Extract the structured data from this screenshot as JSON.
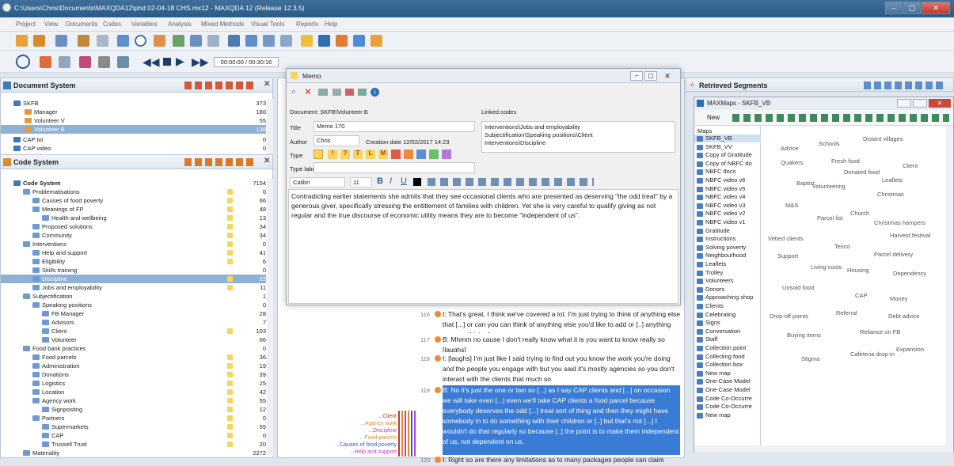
{
  "app": {
    "title": "C:\\Users\\Chris\\Documents\\MAXQDA12\\phd 02-04-18 CHS.mx12 - MAXQDA 12 (Release 12.3.5)"
  },
  "menu": [
    "Project",
    "View",
    "Documents",
    "Codes",
    "Variables",
    "Analysis",
    "Mixed Methods",
    "Visual Tools",
    "Reports",
    "Help"
  ],
  "media": {
    "time": "00:00:00 / 00:30:16"
  },
  "doc_system": {
    "title": "Document System",
    "items": [
      {
        "label": "SKFB",
        "count": "373",
        "indent": 0,
        "sel": false
      },
      {
        "label": "Manager",
        "count": "180",
        "indent": 1,
        "sel": false
      },
      {
        "label": "Volunteer V",
        "count": "55",
        "indent": 1,
        "sel": false
      },
      {
        "label": "Volunteer B",
        "count": "138",
        "indent": 1,
        "sel": true
      },
      {
        "label": "CAP txt",
        "count": "0",
        "indent": 0,
        "sel": false
      },
      {
        "label": "CAP video",
        "count": "0",
        "indent": 0,
        "sel": false
      }
    ]
  },
  "code_system": {
    "title": "Code System",
    "items": [
      {
        "label": "Code System",
        "count": "7154",
        "indent": 0,
        "bold": true,
        "sel": false,
        "y": false
      },
      {
        "label": "Problematisations",
        "count": "0",
        "indent": 1,
        "sel": false,
        "y": true
      },
      {
        "label": "Causes of food poverty",
        "count": "66",
        "indent": 2,
        "sel": false,
        "y": true
      },
      {
        "label": "Meanings of FP",
        "count": "48",
        "indent": 2,
        "sel": false,
        "y": true
      },
      {
        "label": "Health and wellbeing",
        "count": "13",
        "indent": 3,
        "sel": false,
        "y": true
      },
      {
        "label": "Proposed solutions",
        "count": "34",
        "indent": 2,
        "sel": false,
        "y": true
      },
      {
        "label": "Community",
        "count": "34",
        "indent": 2,
        "sel": false,
        "y": true
      },
      {
        "label": "Interventions",
        "count": "0",
        "indent": 1,
        "sel": false,
        "y": true
      },
      {
        "label": "Help and support",
        "count": "41",
        "indent": 2,
        "sel": false,
        "y": true
      },
      {
        "label": "Eligibility",
        "count": "6",
        "indent": 2,
        "sel": false,
        "y": true
      },
      {
        "label": "Skills training",
        "count": "0",
        "indent": 2,
        "sel": false,
        "y": false
      },
      {
        "label": "Discipline",
        "count": "22",
        "indent": 2,
        "sel": true,
        "y": true
      },
      {
        "label": "Jobs and employability",
        "count": "11",
        "indent": 2,
        "sel": false,
        "y": true
      },
      {
        "label": "Subjectification",
        "count": "1",
        "indent": 1,
        "sel": false,
        "y": false
      },
      {
        "label": "Speaking positions",
        "count": "0",
        "indent": 2,
        "sel": false,
        "y": false
      },
      {
        "label": "FB Manager",
        "count": "28",
        "indent": 3,
        "sel": false,
        "y": false
      },
      {
        "label": "Advisors",
        "count": "7",
        "indent": 3,
        "sel": false,
        "y": false
      },
      {
        "label": "Client",
        "count": "103",
        "indent": 3,
        "sel": false,
        "y": true
      },
      {
        "label": "Volunteer",
        "count": "66",
        "indent": 3,
        "sel": false,
        "y": false
      },
      {
        "label": "Food bank practices",
        "count": "0",
        "indent": 1,
        "sel": false,
        "y": false
      },
      {
        "label": "Food parcels",
        "count": "36",
        "indent": 2,
        "sel": false,
        "y": true
      },
      {
        "label": "Administration",
        "count": "19",
        "indent": 2,
        "sel": false,
        "y": true
      },
      {
        "label": "Donations",
        "count": "39",
        "indent": 2,
        "sel": false,
        "y": true
      },
      {
        "label": "Logistics",
        "count": "25",
        "indent": 2,
        "sel": false,
        "y": true
      },
      {
        "label": "Location",
        "count": "42",
        "indent": 2,
        "sel": false,
        "y": true
      },
      {
        "label": "Agency work",
        "count": "55",
        "indent": 2,
        "sel": false,
        "y": true
      },
      {
        "label": "Signposting",
        "count": "12",
        "indent": 3,
        "sel": false,
        "y": true
      },
      {
        "label": "Partners",
        "count": "0",
        "indent": 2,
        "sel": false,
        "y": true
      },
      {
        "label": "Supermarkets",
        "count": "55",
        "indent": 3,
        "sel": false,
        "y": true
      },
      {
        "label": "CAP",
        "count": "0",
        "indent": 3,
        "sel": false,
        "y": true
      },
      {
        "label": "Trussell Trust",
        "count": "20",
        "indent": 3,
        "sel": false,
        "y": true
      },
      {
        "label": "Materiality",
        "count": "2272",
        "indent": 1,
        "sel": false,
        "y": false
      }
    ]
  },
  "memo": {
    "window_title": "Memo",
    "document": "Document: SKFB\\Volunteer B",
    "linked_codes_label": "Linked codes",
    "linked_codes": [
      "Interventions\\Jobs and employability",
      "Subjectification\\Speaking positions\\Client",
      "Interventions\\Discipline"
    ],
    "title_label": "Title",
    "title_value": "Memo 170",
    "author_label": "Author",
    "author_value": "Chris",
    "creation_date": "Creation date  12/02/2017 14:23",
    "type_label": "Type",
    "type_label_label": "Type label",
    "font": "Calibri",
    "font_size": "11",
    "type_letters": [
      "!",
      "?",
      "T",
      "L",
      "M"
    ],
    "body": "Contradicting earlier statements she admits that they see occasional clients who are presented as deserving \"the odd treat\" by a generous giver, specifically stressing the entitlement of families with children. Yet she is very careful to qualify giving as not regular and the true discourse of economic utility means they are to become \"independent of us\"."
  },
  "browser": {
    "segments": [
      {
        "num": "116",
        "text": "I: That's great, I think we've covered a lot. I'm just trying to think of anything else that [...] or can you can think of anything else you'd like to add or [..] anything you can think of"
      },
      {
        "num": "117",
        "text": "B: Mhmm no cause I don't really know what it is you want to know really so [laughs]"
      },
      {
        "num": "118",
        "text": "I: [laughs] I'm just like I said trying to find out you know the work you're doing and the people you engage with but you said it's mostly agencies so you don't interact with the clients that much so"
      },
      {
        "num": "119",
        "text": "B: No it's just the one or two so [...] as I say CAP clients and [...] on occasion we will take even [...] even we'll take CAP clients a food parcel because everybody deserves the odd [...] treat sort of thing and then  they might have somebody in to do something with their children or [..] but that's not [...] I wouldn't do that regularly so because [..] the point is to make them independent of us, not dependent on us."
      },
      {
        "num": "120",
        "text": "I: Right so are there any limitations as to many packages people can claim"
      }
    ],
    "code_tags": [
      {
        "label": "...Client",
        "color": "#c0392b"
      },
      {
        "label": "...Agency work",
        "color": "#e08a2a"
      },
      {
        "label": "...Discipline",
        "color": "#c23ad0"
      },
      {
        "label": "...Food parcels",
        "color": "#e08a2a"
      },
      {
        "label": "...Causes of food poverty",
        "color": "#2c5fc9"
      },
      {
        "label": "...Help and support",
        "color": "#c23ad0"
      }
    ]
  },
  "retrieved": {
    "title": "Retrieved Segments"
  },
  "maxmaps": {
    "window_title": "MAXMaps - SKFB_VB",
    "new_label": "New",
    "maps_header": "Maps",
    "maps": [
      "SKFB_VB",
      "SKFB_VV",
      "Copy of Gratitude",
      "Copy of NBFC do",
      "NBFC docs",
      "NBFC video v6",
      "NBFC video v5",
      "NBFC video v4",
      "NBFC video v3",
      "NBFC video v2",
      "NBFC video v1",
      "Gratitude",
      "Instructions",
      "Solving poverty",
      "Neighbourhood",
      "Leaflets",
      "Trolley",
      "Volunteers",
      "Donors",
      "Approaching shop",
      "Clients",
      "Celebrating",
      "Signs",
      "Conversation",
      "Staff",
      "Collection point",
      "Collecting food",
      "Collection box",
      "New map",
      "One-Case Model",
      "One-Case Model",
      "Code Co-Occurre",
      "Code Co-Occurre",
      "New map"
    ],
    "words": [
      "Distant villages",
      "Schools",
      "Advice",
      "Fresh food",
      "Quakers",
      "Client",
      "Donated food",
      "Leaflets",
      "Baptist",
      "Volunteering",
      "Christmas",
      "M&S",
      "Church",
      "Parcel list",
      "Christmas hampers",
      "Harvest festival",
      "Vetted clients",
      "Tesco",
      "Parcel delivery",
      "Support",
      "Living costs",
      "Housing",
      "Dependency",
      "Unsold food",
      "CAP",
      "Money",
      "Referral",
      "Drop-off points",
      "Debt advice",
      "Reliance on FB",
      "Buying items",
      "Expansion",
      "Cafeteria drop-in",
      "Stigma"
    ]
  }
}
